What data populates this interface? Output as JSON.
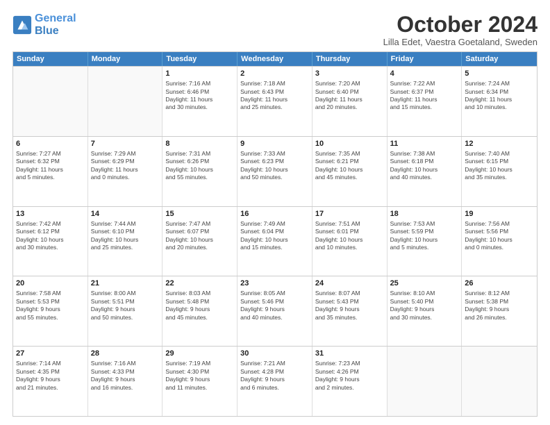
{
  "logo": {
    "line1": "General",
    "line2": "Blue"
  },
  "title": "October 2024",
  "subtitle": "Lilla Edet, Vaestra Goetaland, Sweden",
  "header_days": [
    "Sunday",
    "Monday",
    "Tuesday",
    "Wednesday",
    "Thursday",
    "Friday",
    "Saturday"
  ],
  "rows": [
    [
      {
        "day": "",
        "content": "",
        "empty": true
      },
      {
        "day": "",
        "content": "",
        "empty": true
      },
      {
        "day": "1",
        "content": "Sunrise: 7:16 AM\nSunset: 6:46 PM\nDaylight: 11 hours\nand 30 minutes.",
        "empty": false
      },
      {
        "day": "2",
        "content": "Sunrise: 7:18 AM\nSunset: 6:43 PM\nDaylight: 11 hours\nand 25 minutes.",
        "empty": false
      },
      {
        "day": "3",
        "content": "Sunrise: 7:20 AM\nSunset: 6:40 PM\nDaylight: 11 hours\nand 20 minutes.",
        "empty": false
      },
      {
        "day": "4",
        "content": "Sunrise: 7:22 AM\nSunset: 6:37 PM\nDaylight: 11 hours\nand 15 minutes.",
        "empty": false
      },
      {
        "day": "5",
        "content": "Sunrise: 7:24 AM\nSunset: 6:34 PM\nDaylight: 11 hours\nand 10 minutes.",
        "empty": false
      }
    ],
    [
      {
        "day": "6",
        "content": "Sunrise: 7:27 AM\nSunset: 6:32 PM\nDaylight: 11 hours\nand 5 minutes.",
        "empty": false
      },
      {
        "day": "7",
        "content": "Sunrise: 7:29 AM\nSunset: 6:29 PM\nDaylight: 11 hours\nand 0 minutes.",
        "empty": false
      },
      {
        "day": "8",
        "content": "Sunrise: 7:31 AM\nSunset: 6:26 PM\nDaylight: 10 hours\nand 55 minutes.",
        "empty": false
      },
      {
        "day": "9",
        "content": "Sunrise: 7:33 AM\nSunset: 6:23 PM\nDaylight: 10 hours\nand 50 minutes.",
        "empty": false
      },
      {
        "day": "10",
        "content": "Sunrise: 7:35 AM\nSunset: 6:21 PM\nDaylight: 10 hours\nand 45 minutes.",
        "empty": false
      },
      {
        "day": "11",
        "content": "Sunrise: 7:38 AM\nSunset: 6:18 PM\nDaylight: 10 hours\nand 40 minutes.",
        "empty": false
      },
      {
        "day": "12",
        "content": "Sunrise: 7:40 AM\nSunset: 6:15 PM\nDaylight: 10 hours\nand 35 minutes.",
        "empty": false
      }
    ],
    [
      {
        "day": "13",
        "content": "Sunrise: 7:42 AM\nSunset: 6:12 PM\nDaylight: 10 hours\nand 30 minutes.",
        "empty": false
      },
      {
        "day": "14",
        "content": "Sunrise: 7:44 AM\nSunset: 6:10 PM\nDaylight: 10 hours\nand 25 minutes.",
        "empty": false
      },
      {
        "day": "15",
        "content": "Sunrise: 7:47 AM\nSunset: 6:07 PM\nDaylight: 10 hours\nand 20 minutes.",
        "empty": false
      },
      {
        "day": "16",
        "content": "Sunrise: 7:49 AM\nSunset: 6:04 PM\nDaylight: 10 hours\nand 15 minutes.",
        "empty": false
      },
      {
        "day": "17",
        "content": "Sunrise: 7:51 AM\nSunset: 6:01 PM\nDaylight: 10 hours\nand 10 minutes.",
        "empty": false
      },
      {
        "day": "18",
        "content": "Sunrise: 7:53 AM\nSunset: 5:59 PM\nDaylight: 10 hours\nand 5 minutes.",
        "empty": false
      },
      {
        "day": "19",
        "content": "Sunrise: 7:56 AM\nSunset: 5:56 PM\nDaylight: 10 hours\nand 0 minutes.",
        "empty": false
      }
    ],
    [
      {
        "day": "20",
        "content": "Sunrise: 7:58 AM\nSunset: 5:53 PM\nDaylight: 9 hours\nand 55 minutes.",
        "empty": false
      },
      {
        "day": "21",
        "content": "Sunrise: 8:00 AM\nSunset: 5:51 PM\nDaylight: 9 hours\nand 50 minutes.",
        "empty": false
      },
      {
        "day": "22",
        "content": "Sunrise: 8:03 AM\nSunset: 5:48 PM\nDaylight: 9 hours\nand 45 minutes.",
        "empty": false
      },
      {
        "day": "23",
        "content": "Sunrise: 8:05 AM\nSunset: 5:46 PM\nDaylight: 9 hours\nand 40 minutes.",
        "empty": false
      },
      {
        "day": "24",
        "content": "Sunrise: 8:07 AM\nSunset: 5:43 PM\nDaylight: 9 hours\nand 35 minutes.",
        "empty": false
      },
      {
        "day": "25",
        "content": "Sunrise: 8:10 AM\nSunset: 5:40 PM\nDaylight: 9 hours\nand 30 minutes.",
        "empty": false
      },
      {
        "day": "26",
        "content": "Sunrise: 8:12 AM\nSunset: 5:38 PM\nDaylight: 9 hours\nand 26 minutes.",
        "empty": false
      }
    ],
    [
      {
        "day": "27",
        "content": "Sunrise: 7:14 AM\nSunset: 4:35 PM\nDaylight: 9 hours\nand 21 minutes.",
        "empty": false
      },
      {
        "day": "28",
        "content": "Sunrise: 7:16 AM\nSunset: 4:33 PM\nDaylight: 9 hours\nand 16 minutes.",
        "empty": false
      },
      {
        "day": "29",
        "content": "Sunrise: 7:19 AM\nSunset: 4:30 PM\nDaylight: 9 hours\nand 11 minutes.",
        "empty": false
      },
      {
        "day": "30",
        "content": "Sunrise: 7:21 AM\nSunset: 4:28 PM\nDaylight: 9 hours\nand 6 minutes.",
        "empty": false
      },
      {
        "day": "31",
        "content": "Sunrise: 7:23 AM\nSunset: 4:26 PM\nDaylight: 9 hours\nand 2 minutes.",
        "empty": false
      },
      {
        "day": "",
        "content": "",
        "empty": true
      },
      {
        "day": "",
        "content": "",
        "empty": true
      }
    ]
  ]
}
